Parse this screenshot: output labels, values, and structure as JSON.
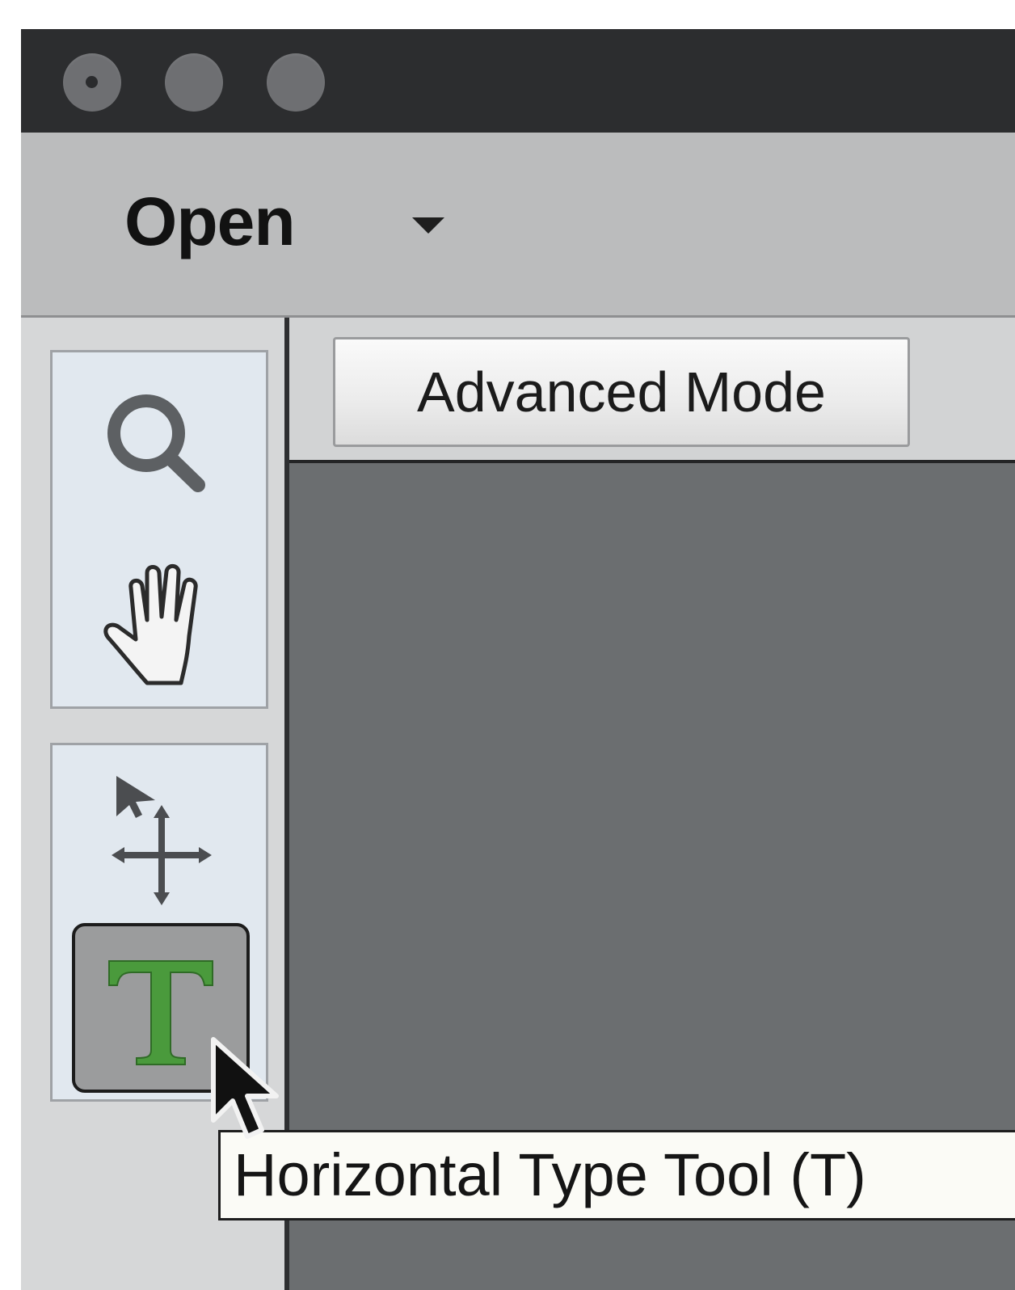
{
  "window": {
    "traffic_lights": [
      "close",
      "minimize",
      "zoom"
    ]
  },
  "toolbar": {
    "open_label": "Open",
    "open_dropdown_icon": "caret-down-icon"
  },
  "mode": {
    "button_label": "Advanced Mode"
  },
  "tools": [
    {
      "name": "zoom",
      "icon": "magnifier-icon",
      "selected": false
    },
    {
      "name": "hand",
      "icon": "hand-icon",
      "selected": false
    },
    {
      "name": "move",
      "icon": "move-icon",
      "selected": false
    },
    {
      "name": "horizontal-type",
      "icon": "type-icon",
      "selected": true
    }
  ],
  "tooltip": {
    "text": "Horizontal Type Tool (T)"
  },
  "colors": {
    "type_tool_green": "#4a9a3c",
    "canvas_gray": "#6b6e70",
    "titlebar": "#2c2d2f"
  }
}
